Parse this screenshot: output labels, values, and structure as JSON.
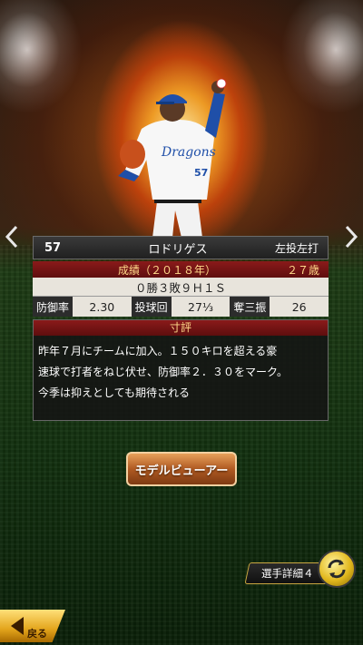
{
  "player": {
    "number": "57",
    "name": "ロドリゲス",
    "handedness": "左投左打"
  },
  "record": {
    "title": "成績（２０１８年）",
    "age": "２７歳",
    "summary": "０勝３敗９Ｈ１Ｓ",
    "stats": [
      {
        "label": "防御率",
        "value": "2.30"
      },
      {
        "label": "投球回",
        "value": "27⅓"
      },
      {
        "label": "奪三振",
        "value": "26"
      }
    ]
  },
  "comment": {
    "title": "寸評",
    "lines": [
      "昨年７月にチームに加入。１５０キロを超える豪",
      "速球で打者をねじ伏せ、防御率２．３０をマーク。",
      "今季は抑えとしても期待される"
    ]
  },
  "buttons": {
    "model_viewer": "モデルビューアー",
    "player_detail": "選手詳細４",
    "back": "戻る"
  },
  "icons": {
    "prev": "chevron-left-icon",
    "next": "chevron-right-icon",
    "switch": "swap-arrows-icon",
    "back": "back-arrow-icon"
  },
  "colors": {
    "title_bar_red": "#7a1414",
    "title_text_gold": "#ffd98a",
    "button_orange": "#c0692a",
    "switch_gold": "#e2b81e"
  }
}
